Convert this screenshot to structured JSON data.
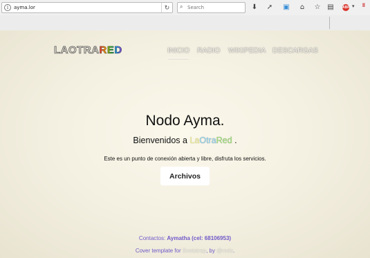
{
  "browser": {
    "url": "ayma.lor",
    "search_placeholder": "Search",
    "reload_icon": "reload-icon",
    "icons": [
      "download-icon",
      "send-icon",
      "screenshot-icon",
      "home-icon",
      "bookmark-star-icon",
      "library-icon",
      "adblock-icon",
      "extension-icon"
    ],
    "adblock_label": "ABP"
  },
  "site": {
    "logo_part1": "LAOTRA",
    "logo_part2": "RED",
    "nav": [
      {
        "label": "Inicio",
        "active": true
      },
      {
        "label": "Radio",
        "active": false
      },
      {
        "label": "Wikipedia",
        "active": false
      },
      {
        "label": "Descargas",
        "active": false
      }
    ],
    "headline": "Nodo Ayma.",
    "welcome_prefix": "Bienvenidos a",
    "welcome_brand_a": "La",
    "welcome_brand_b": "Otra",
    "welcome_brand_c": "Red",
    "welcome_suffix": ".",
    "intro": "Este es un punto de conexión abierta y libre, disfruta los servicios.",
    "archive_button": "Archivos",
    "contact_label": "Contactos:",
    "contact_value": "Aymatha (cel: 68106953)",
    "credit_prefix": "Cover template for",
    "credit_link1": "Bootstrap",
    "credit_mid": ", by",
    "credit_link2": "@mdo",
    "credit_suffix": "."
  },
  "colors": {
    "page_bg": "#f3efe0",
    "footer_text": "#6f58c9",
    "nav_text": "#f7f4ea"
  }
}
